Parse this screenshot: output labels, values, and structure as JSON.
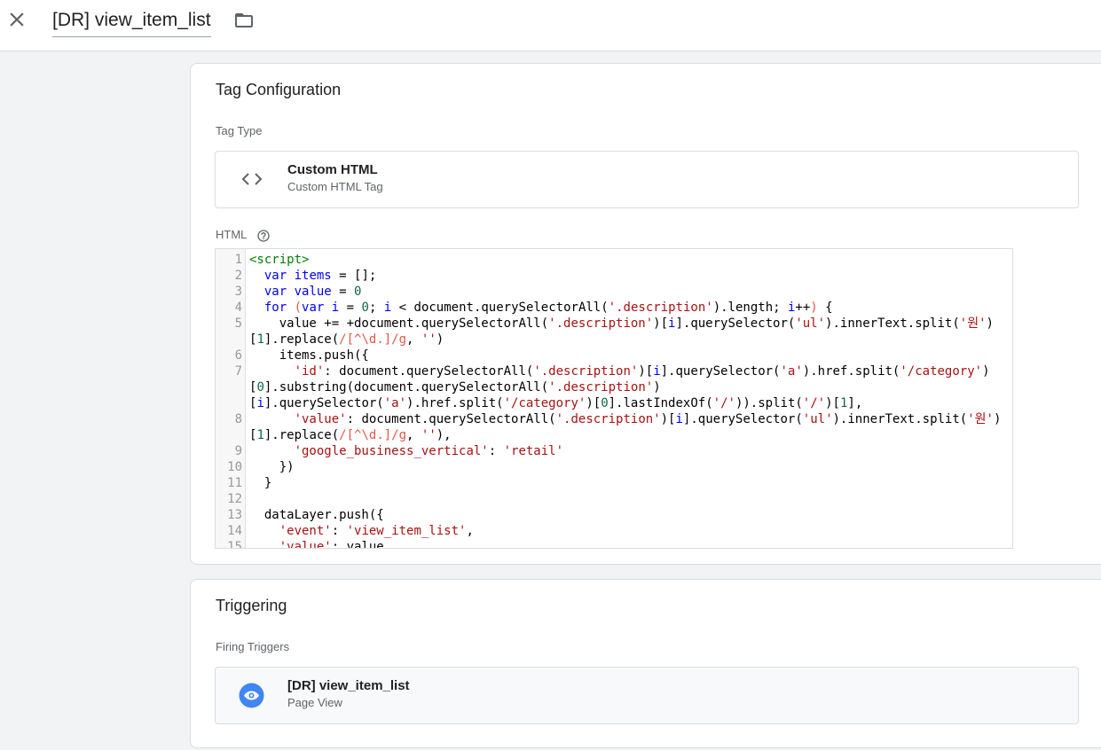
{
  "header": {
    "tag_name": "[DR] view_item_list",
    "close_icon": "close-icon",
    "folder_icon": "folder-icon"
  },
  "tag_config": {
    "title": "Tag Configuration",
    "tag_type_label": "Tag Type",
    "tag_type_name": "Custom HTML",
    "tag_type_desc": "Custom HTML Tag",
    "html_label": "HTML",
    "code_lines": [
      {
        "n": "1",
        "html": "<span class=\"tag\">&lt;script&gt;</span>"
      },
      {
        "n": "2",
        "html": "  <span class=\"kw\">var</span> <span class=\"var\">items</span> = [];"
      },
      {
        "n": "3",
        "html": "  <span class=\"kw\">var</span> <span class=\"var\">value</span> = <span class=\"num\">0</span>"
      },
      {
        "n": "4",
        "html": "  <span class=\"kw\">for</span> <span class=\"re\">(</span><span class=\"kw\">var</span> <span class=\"var\">i</span> = <span class=\"num\">0</span>; <span class=\"var\">i</span> &lt; document.querySelectorAll(<span class=\"str\">'.description'</span>).length; <span class=\"var\">i</span>++<span class=\"re\">)</span> {"
      },
      {
        "n": "5",
        "html": "    value += +document.querySelectorAll(<span class=\"str\">'.description'</span>)[<span class=\"var\">i</span>].querySelector(<span class=\"str\">'ul'</span>).innerText.split(<span class=\"str\">'원'</span>)\n[<span class=\"num\">1</span>].replace(<span class=\"re\">/[^\\d.]/g</span>, <span class=\"str\">''</span>)"
      },
      {
        "n": "6",
        "html": "    items.push({"
      },
      {
        "n": "7",
        "html": "      <span class=\"str\">'id'</span>: document.querySelectorAll(<span class=\"str\">'.description'</span>)[<span class=\"var\">i</span>].querySelector(<span class=\"str\">'a'</span>).href.split(<span class=\"str\">'/category'</span>)\n[<span class=\"num\">0</span>].substring(document.querySelectorAll(<span class=\"str\">'.description'</span>)\n[<span class=\"var\">i</span>].querySelector(<span class=\"str\">'a'</span>).href.split(<span class=\"str\">'/category'</span>)[<span class=\"num\">0</span>].lastIndexOf(<span class=\"str\">'/'</span>)).split(<span class=\"str\">'/'</span>)[<span class=\"num\">1</span>],"
      },
      {
        "n": "8",
        "html": "      <span class=\"str\">'value'</span>: document.querySelectorAll(<span class=\"str\">'.description'</span>)[<span class=\"var\">i</span>].querySelector(<span class=\"str\">'ul'</span>).innerText.split(<span class=\"str\">'원'</span>)\n[<span class=\"num\">1</span>].replace(<span class=\"re\">/[^\\d.]/g</span>, <span class=\"str\">''</span>),"
      },
      {
        "n": "9",
        "html": "      <span class=\"str\">'google_business_vertical'</span>: <span class=\"str\">'retail'</span>"
      },
      {
        "n": "10",
        "html": "    })"
      },
      {
        "n": "11",
        "html": "  }"
      },
      {
        "n": "12",
        "html": ""
      },
      {
        "n": "13",
        "html": "  dataLayer.push({"
      },
      {
        "n": "14",
        "html": "    <span class=\"str\">'event'</span>: <span class=\"str\">'view_item_list'</span>,"
      },
      {
        "n": "15",
        "html": "    <span class=\"str\">'value'</span>: value,"
      }
    ]
  },
  "triggering": {
    "title": "Triggering",
    "firing_label": "Firing Triggers",
    "trigger_name": "[DR] view_item_list",
    "trigger_type": "Page View"
  }
}
